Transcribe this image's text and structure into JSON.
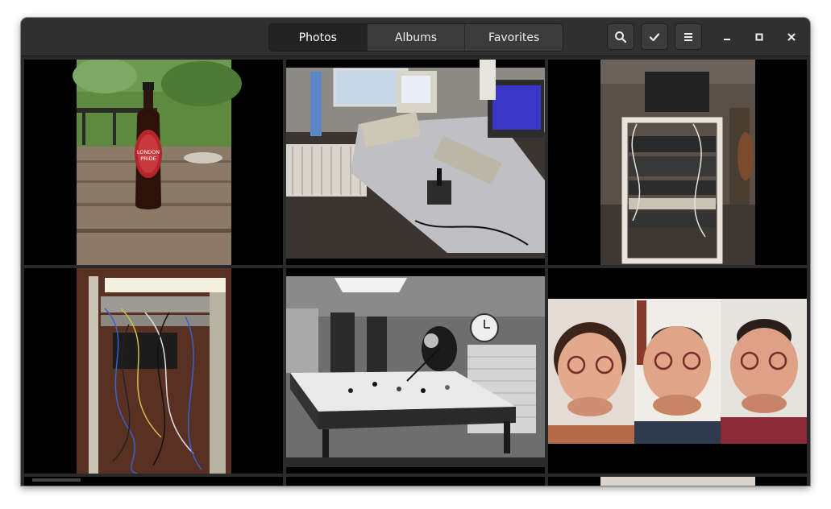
{
  "app": {
    "window": "photos-window"
  },
  "header": {
    "tabs": [
      {
        "label": "Photos",
        "active": true
      },
      {
        "label": "Albums",
        "active": false
      },
      {
        "label": "Favorites",
        "active": false
      }
    ],
    "buttons": [
      "search-icon",
      "select-check-icon",
      "hamburger-menu-icon"
    ],
    "window_controls": [
      "minimize-icon",
      "maximize-icon",
      "close-icon"
    ]
  },
  "colors": {
    "headerbar": "#303030",
    "active_tab": "#232323",
    "grid_background": "#2a2a2a",
    "letterbox": "#000000"
  },
  "photos": {
    "beer": {
      "label_line1": "LONDON",
      "label_line2": "PRIDE"
    }
  }
}
